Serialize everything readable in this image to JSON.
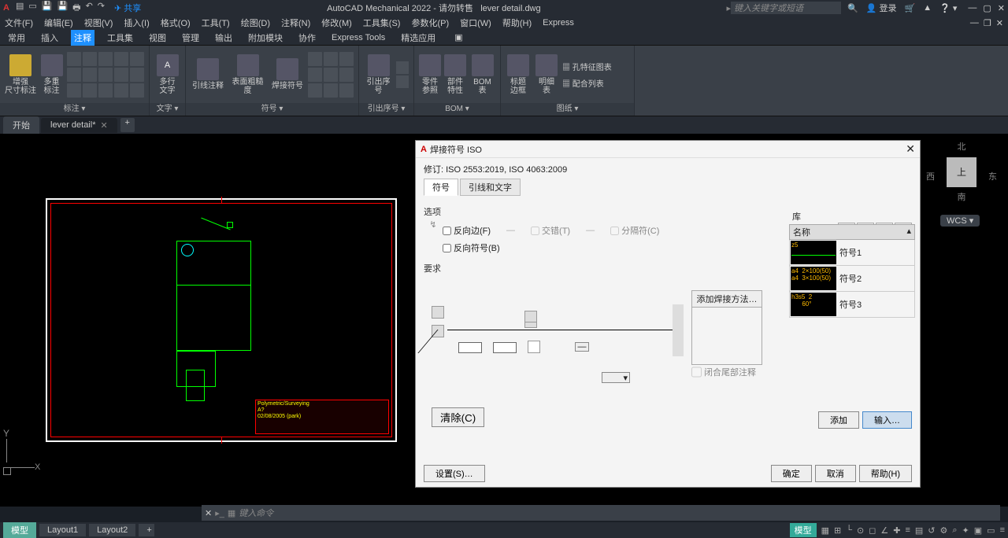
{
  "title": {
    "app": "AutoCAD Mechanical 2022",
    "note": "请勿转售",
    "file": "lever detail.dwg",
    "share": "共享",
    "search_ph": "键入关键字或短语",
    "login": "登录"
  },
  "menus": [
    "文件(F)",
    "编辑(E)",
    "视图(V)",
    "插入(I)",
    "格式(O)",
    "工具(T)",
    "绘图(D)",
    "注释(N)",
    "修改(M)",
    "工具集(S)",
    "参数化(P)",
    "窗口(W)",
    "帮助(H)",
    "Express"
  ],
  "ribtabs": [
    "常用",
    "插入",
    "注释",
    "工具集",
    "视图",
    "管理",
    "输出",
    "附加模块",
    "协作",
    "Express Tools",
    "精选应用"
  ],
  "ribtab_active": 2,
  "panels": {
    "p1": {
      "label": "标注",
      "b1": "增强\n尺寸标注",
      "b2": "多重\n标注"
    },
    "p2": {
      "label": "文字",
      "b1": "多行\n文字"
    },
    "p3": {
      "label": "符号",
      "b1": "引线注释",
      "b2": "表面粗糙度",
      "b3": "焊接符号"
    },
    "p4": {
      "label": "引出序号",
      "b1": "引出序号"
    },
    "p5": {
      "label": "BOM",
      "b1": "零件\n参照",
      "b2": "部件\n特性",
      "b3": "BOM 表"
    },
    "p6": {
      "label": "图纸",
      "b1": "标题\n边框",
      "b2": "明细\n表",
      "i1": "孔特征图表",
      "i2": "配合列表"
    }
  },
  "doctabs": {
    "t1": "开始",
    "t2": "lever detail*",
    "add": "+"
  },
  "viewcube": {
    "n": "北",
    "s": "南",
    "e": "东",
    "w": "西",
    "top": "上",
    "wcs": "WCS"
  },
  "dialog": {
    "title": "焊接符号 ISO",
    "rev": "修订: ISO 2553:2019, ISO 4063:2009",
    "tab1": "符号",
    "tab2": "引线和文字",
    "sec_opts": "选项",
    "opt_flip": "反向边(F)",
    "opt_stagger": "交错(T)",
    "opt_sep": "分隔符(C)",
    "opt_flipsym": "反向符号(B)",
    "sec_req": "要求",
    "add_method": "添加焊接方法…",
    "tail_note": "闭合尾部注释",
    "lib": "库",
    "lib_name": "名称",
    "items": [
      "符号1",
      "符号2",
      "符号3"
    ],
    "thumbs": [
      "z5",
      "a4  2×100(50)\na4  3×100(50)",
      "h3s5  2\n      60°"
    ],
    "clear": "清除(C)",
    "add": "添加",
    "import": "输入…",
    "settings": "设置(S)…",
    "ok": "确定",
    "cancel": "取消",
    "help": "帮助(H)"
  },
  "cmd": {
    "prompt": "键入命令"
  },
  "layouts": [
    "模型",
    "Layout1",
    "Layout2"
  ],
  "status": {
    "model": "模型"
  }
}
